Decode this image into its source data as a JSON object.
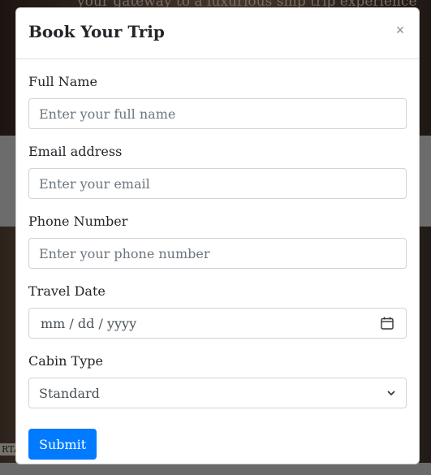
{
  "background": {
    "tagline": "your gateway to a luxurious ship trip experience",
    "image_label": "RTA"
  },
  "modal": {
    "title": "Book Your Trip",
    "close_glyph": "×",
    "fields": {
      "full_name": {
        "label": "Full Name",
        "placeholder": "Enter your full name",
        "value": ""
      },
      "email": {
        "label": "Email address",
        "placeholder": "Enter your email",
        "value": ""
      },
      "phone": {
        "label": "Phone Number",
        "placeholder": "Enter your phone number",
        "value": ""
      },
      "travel_date": {
        "label": "Travel Date",
        "display": "mm / dd / yyyy",
        "icon": "calendar-icon"
      },
      "cabin_type": {
        "label": "Cabin Type",
        "selected": "Standard",
        "icon": "chevron-down-icon"
      }
    },
    "submit_label": "Submit"
  },
  "colors": {
    "primary": "#007bff",
    "backdrop": "rgba(0,0,0,0.5)"
  }
}
